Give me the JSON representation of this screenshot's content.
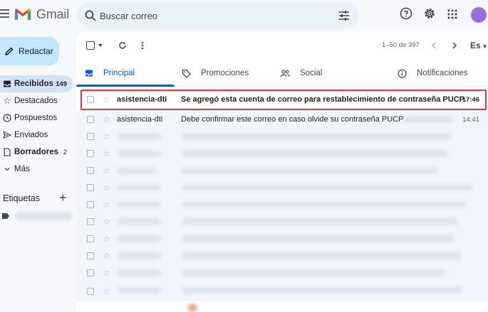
{
  "header": {
    "app_name": "Gmail",
    "search_placeholder": "Buscar correo",
    "icons": [
      "menu-icon",
      "search-icon",
      "tune-icon",
      "help-icon",
      "settings-icon",
      "apps-icon"
    ],
    "brand_colors": {
      "red": "#ea4335",
      "blue": "#4285f4",
      "green": "#34a853",
      "yellow": "#fbbc04"
    }
  },
  "sidebar": {
    "compose_label": "Redactar",
    "items": [
      {
        "label": "Recibidos",
        "count": "149",
        "icon": "inbox-icon",
        "active": true
      },
      {
        "label": "Destacados",
        "count": "",
        "icon": "star-icon"
      },
      {
        "label": "Pospuestos",
        "count": "",
        "icon": "clock-icon"
      },
      {
        "label": "Enviados",
        "count": "",
        "icon": "send-icon"
      },
      {
        "label": "Borradores",
        "count": "2",
        "icon": "draft-icon",
        "bold": true
      },
      {
        "label": "Más",
        "count": "",
        "icon": "chevron-down-icon"
      }
    ],
    "labels_title": "Etiquetas",
    "labels_add": "+"
  },
  "toolbar": {
    "pager": "1–50 de 397",
    "language": "Es"
  },
  "tabs": [
    {
      "label": "Principal",
      "icon": "inbox-tab-icon",
      "active": true
    },
    {
      "label": "Promociones",
      "icon": "tag-icon"
    },
    {
      "label": "Social",
      "icon": "people-icon"
    },
    {
      "label": "Notificaciones",
      "icon": "info-icon"
    }
  ],
  "emails": [
    {
      "sender": "asistencia-dti",
      "subject": "Se agregó esta cuenta de correo para restablecimiento de contraseña PUCP",
      "time": "17:46",
      "unread": true,
      "highlighted": true
    },
    {
      "sender": "asistencia-dti",
      "subject": "Debe confirmar este correo en caso olvide su contraseña PUCP -",
      "time": "14:41",
      "unread": false
    }
  ],
  "highlight_color": "#e03a3a"
}
